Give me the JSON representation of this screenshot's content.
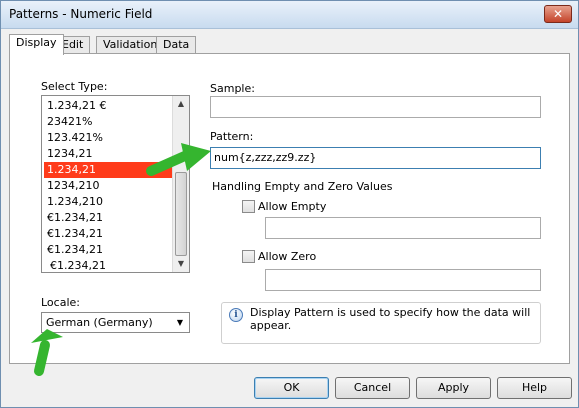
{
  "window": {
    "title": "Patterns - Numeric Field",
    "close_glyph": "✕"
  },
  "tabs": [
    {
      "label": "Display",
      "active": true
    },
    {
      "label": "Edit",
      "active": false
    },
    {
      "label": "Validation",
      "active": false
    },
    {
      "label": "Data",
      "active": false
    }
  ],
  "select_type": {
    "label": "Select Type:",
    "items": [
      "1.234,21 €",
      "23421%",
      "123.421%",
      "1234,21",
      "1.234,21",
      "1234,210",
      "1.234,210",
      "€1.234,21",
      "€1.234,21",
      "€1.234,21",
      "€1.234,21"
    ],
    "selected_index": 4
  },
  "locale": {
    "label": "Locale:",
    "value": "German (Germany)"
  },
  "sample": {
    "label": "Sample:",
    "value": ""
  },
  "pattern": {
    "label": "Pattern:",
    "value": "num{z,zzz,zz9.zz}"
  },
  "handling": {
    "heading": "Handling Empty and Zero Values",
    "allow_empty_label": "Allow Empty",
    "allow_empty_checked": false,
    "allow_empty_value": "",
    "allow_zero_label": "Allow Zero",
    "allow_zero_checked": false,
    "allow_zero_value": ""
  },
  "info": {
    "icon": "info-icon",
    "text": "Display Pattern is used to specify how the data will appear."
  },
  "buttons": {
    "ok": "OK",
    "cancel": "Cancel",
    "apply": "Apply",
    "help": "Help"
  },
  "colors": {
    "selection": "#ff3b1a",
    "annotation_arrow": "#35b52f"
  }
}
